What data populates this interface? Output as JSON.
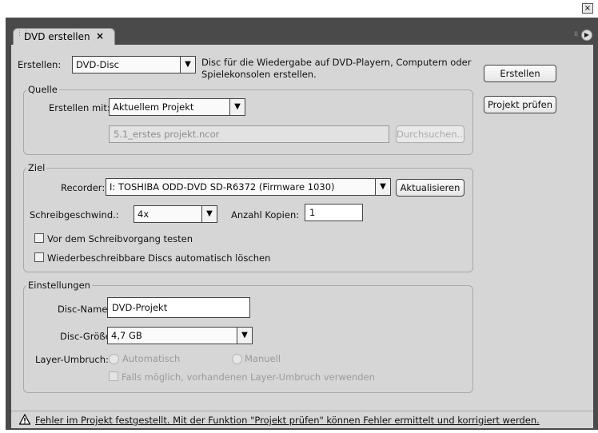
{
  "window": {
    "close_glyph": "×"
  },
  "tab": {
    "label": "DVD erstellen",
    "close_glyph": "×",
    "grip_icon": "grip-icon",
    "menu_icon": "panel-menu-icon"
  },
  "create": {
    "label": "Erstellen:",
    "value": "DVD-Disc",
    "description_line1": "Disc für die Wiedergabe auf DVD-Playern, Computern oder",
    "description_line2": "Spielekonsolen erstellen."
  },
  "buttons": {
    "erstellen": "Erstellen",
    "projekt_pruefen": "Projekt prüfen"
  },
  "quelle": {
    "legend": "Quelle",
    "erstellen_mit_label": "Erstellen mit:",
    "erstellen_mit_value": "Aktuellem Projekt",
    "file_path": "5.1_erstes projekt.ncor",
    "browse": "Durchsuchen..."
  },
  "ziel": {
    "legend": "Ziel",
    "recorder_label": "Recorder:",
    "recorder_value": "I: TOSHIBA ODD-DVD SD-R6372 (Firmware 1030)",
    "refresh": "Aktualisieren",
    "speed_label": "Schreibgeschwind.:",
    "speed_value": "4x",
    "copies_label": "Anzahl Kopien:",
    "copies_value": "1",
    "test_before_write": "Vor dem Schreibvorgang testen",
    "auto_erase": "Wiederbeschreibbare Discs automatisch löschen"
  },
  "einstellungen": {
    "legend": "Einstellungen",
    "disc_name_label": "Disc-Name:",
    "disc_name_value": "DVD-Projekt",
    "disc_size_label": "Disc-Größe:",
    "disc_size_value": "4,7 GB",
    "layer_break_label": "Layer-Umbruch:",
    "automatic": "Automatisch",
    "manual": "Manuell",
    "use_existing": "Falls möglich, vorhandenen Layer-Umbruch verwenden"
  },
  "status": {
    "icon": "warning-icon",
    "message": "Fehler im Projekt festgestellt. Mit der Funktion \"Projekt prüfen\" können Fehler ermittelt und korrigiert werden."
  }
}
